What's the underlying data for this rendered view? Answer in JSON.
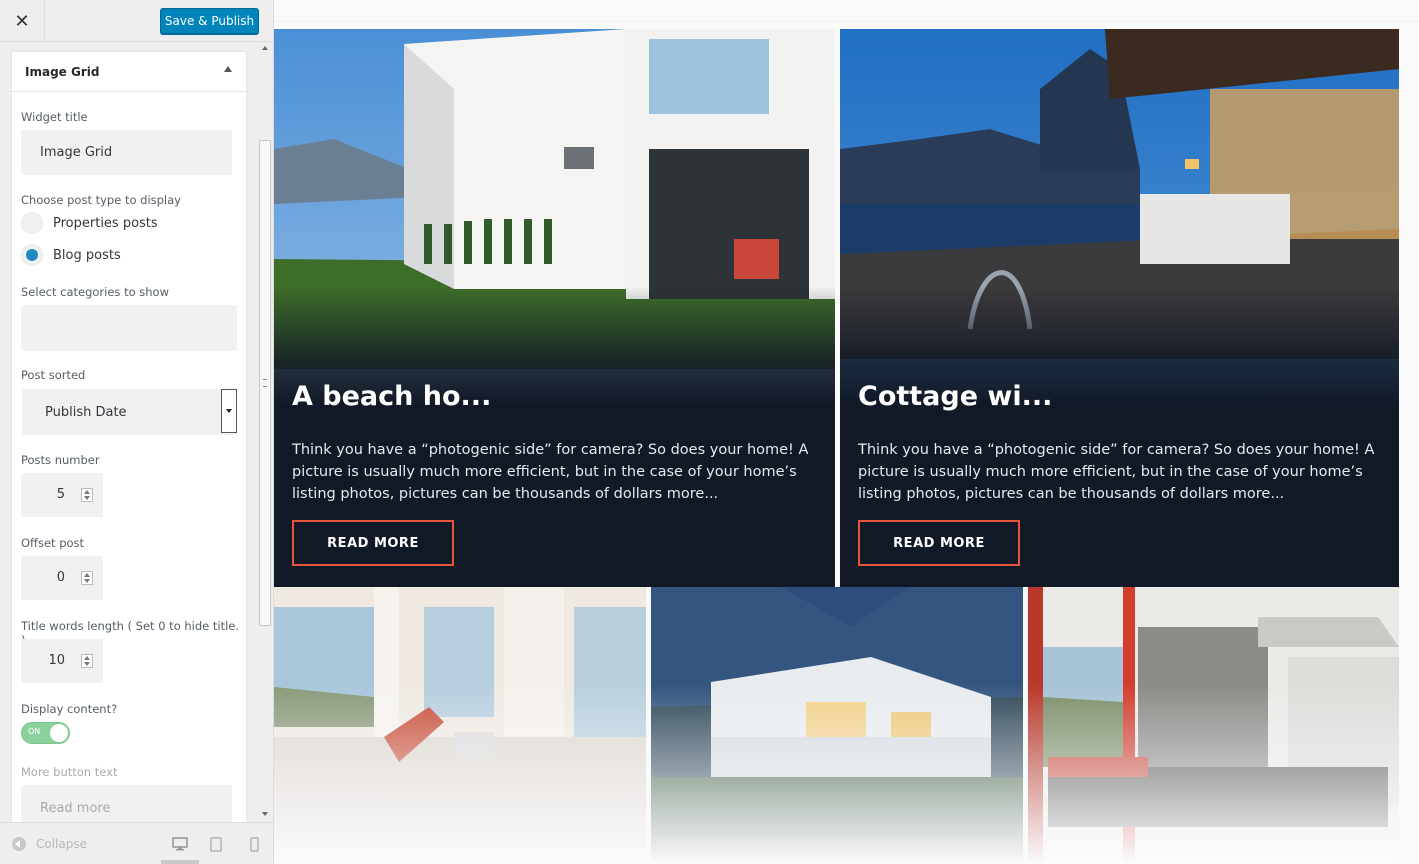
{
  "toolbar": {
    "close_icon": "close-icon",
    "publish_label": "Save & Publish"
  },
  "widget": {
    "header": "Image Grid",
    "title_label": "Widget title",
    "title_value": "Image Grid",
    "post_type_label": "Choose post type to display",
    "post_types": [
      {
        "label": "Properties posts",
        "selected": false
      },
      {
        "label": "Blog posts",
        "selected": true
      }
    ],
    "categories_label": "Select categories to show",
    "sorted_label": "Post sorted",
    "sorted_value": "Publish Date",
    "posts_number_label": "Posts number",
    "posts_number_value": "5",
    "offset_label": "Offset post",
    "offset_value": "0",
    "title_length_label": "Title words length ( Set 0 to hide title. )",
    "title_length_value": "10",
    "display_content_label": "Display content?",
    "display_content_toggle": "ON",
    "more_button_label": "More button text",
    "more_button_placeholder": "Read more"
  },
  "footer": {
    "collapse_label": "Collapse",
    "devices": [
      "desktop-icon",
      "tablet-icon",
      "mobile-icon"
    ]
  },
  "preview": {
    "cards": [
      {
        "title": "A beach ho...",
        "excerpt": "Think you have a “photogenic side” for camera? So does your home! A picture is usually much more efficient, but in the case of your home’s listing photos, pictures can be thousands of dollars more...",
        "button": "READ MORE"
      },
      {
        "title": "Cottage wi...",
        "excerpt": "Think you have a “photogenic side” for camera? So does your home! A picture is usually much more efficient, but in the case of your home’s listing photos, pictures can be thousands of dollars more...",
        "button": "READ MORE"
      }
    ],
    "accent_color": "#e8553a",
    "overlay_color": "#111826"
  }
}
